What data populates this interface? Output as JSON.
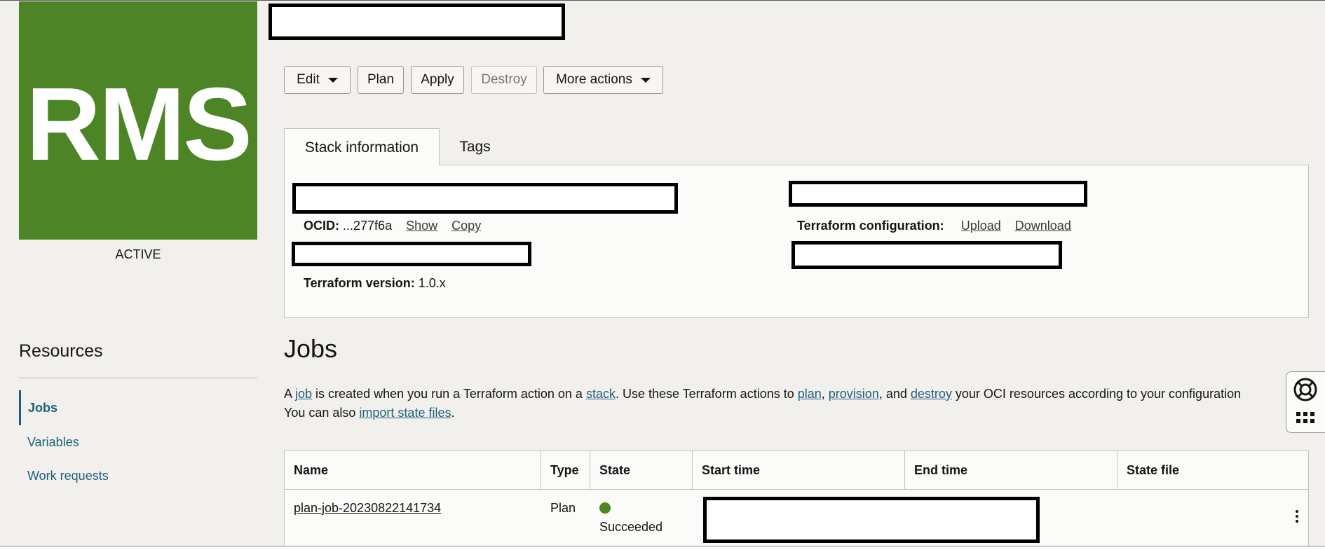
{
  "stack": {
    "logo_text": "RMS",
    "status": "ACTIVE"
  },
  "actions": {
    "edit": "Edit",
    "plan": "Plan",
    "apply": "Apply",
    "destroy": "Destroy",
    "more": "More actions"
  },
  "tabs": [
    {
      "label": "Stack information"
    },
    {
      "label": "Tags"
    }
  ],
  "info": {
    "ocid_label": "OCID:",
    "ocid_value": "...277f6a",
    "show": "Show",
    "copy": "Copy",
    "tf_config_label": "Terraform configuration:",
    "upload": "Upload",
    "download": "Download",
    "tf_version_label": "Terraform version:",
    "tf_version_value": "1.0.x"
  },
  "resources": {
    "title": "Resources",
    "items": [
      {
        "label": "Jobs"
      },
      {
        "label": "Variables"
      },
      {
        "label": "Work requests"
      }
    ]
  },
  "jobs": {
    "title": "Jobs",
    "desc": {
      "t1": "A ",
      "job": "job",
      "t2": " is created when you run a Terraform action on a ",
      "stack": "stack",
      "t3": ". Use these Terraform actions to ",
      "plan": "plan",
      "t4": ", ",
      "provision": "provision",
      "t5": ", and ",
      "destroy": "destroy",
      "t6": " your OCI resources according to your configuration",
      "t7": "You can also ",
      "import": "import state files",
      "t8": "."
    },
    "columns": [
      "Name",
      "Type",
      "State",
      "Start time",
      "End time",
      "State file"
    ],
    "rows": [
      {
        "name": "plan-job-20230822141734",
        "type": "Plan",
        "state": "Succeeded"
      }
    ]
  },
  "colors": {
    "brand_green": "#4d8526",
    "link": "#1f5f7a"
  }
}
